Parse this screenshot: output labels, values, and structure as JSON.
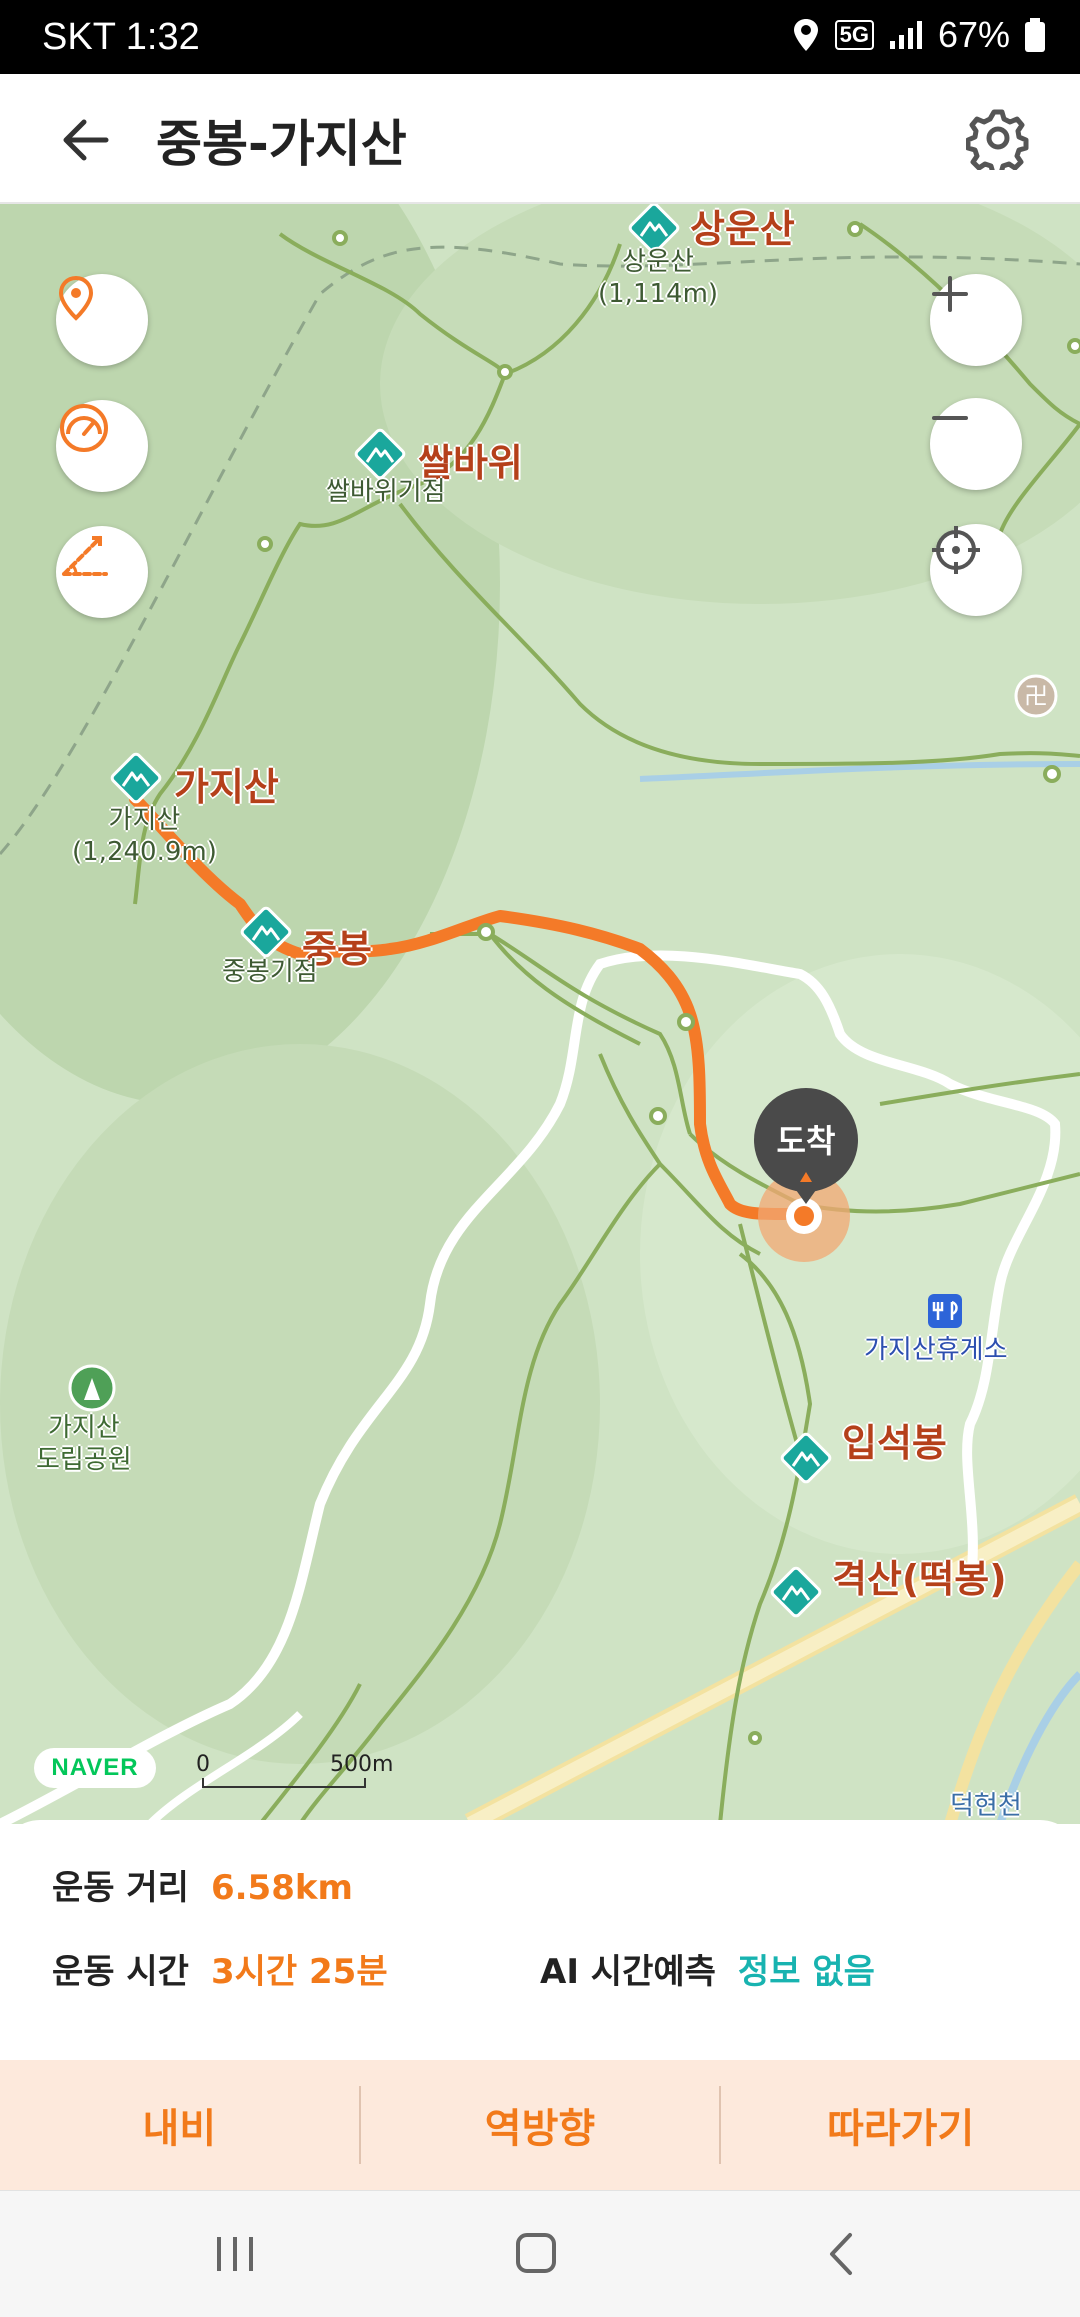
{
  "status_bar": {
    "carrier_time": "SKT 1:32",
    "network": "5G",
    "battery": "67%"
  },
  "header": {
    "title": "중봉-가지산",
    "back_icon": "arrow-left-icon",
    "settings_icon": "gear-icon"
  },
  "map": {
    "peaks": [
      {
        "id": "sangunsan",
        "name": "상운산",
        "sub": "상운산\n(1,114m)"
      },
      {
        "id": "ssalbawi",
        "name": "쌀바위",
        "sub": "쌀바위기점"
      },
      {
        "id": "gajisan",
        "name": "가지산",
        "sub": "가지산\n(1,240.9m)"
      },
      {
        "id": "jungbong",
        "name": "중봉",
        "sub": "중봉기점"
      },
      {
        "id": "ipseokbong",
        "name": "입석봉",
        "sub": ""
      },
      {
        "id": "gyeoksan",
        "name": "격산(떡봉)",
        "sub": ""
      }
    ],
    "park_label": "가지산\n도립공원",
    "rest_area": "가지산휴게소",
    "stream": "덕현천",
    "arrival": "도착",
    "naver": "NAVER",
    "scale": {
      "zero": "0",
      "dist": "500m"
    },
    "temple_char": "卍",
    "colors": {
      "route": "#f47a28",
      "trail": "#8aad5c",
      "road": "#ffffff",
      "highway": "#f5e8a6",
      "peak": "#1aa79c"
    }
  },
  "summary": {
    "distance_label": "운동 거리",
    "distance_value": "6.58km",
    "time_label": "운동 시간",
    "time_value": "3시간 25분",
    "ai_label": "AI 시간예측",
    "ai_value": "정보 없음"
  },
  "actions": {
    "nav": "내비",
    "reverse": "역방향",
    "follow": "따라가기"
  }
}
